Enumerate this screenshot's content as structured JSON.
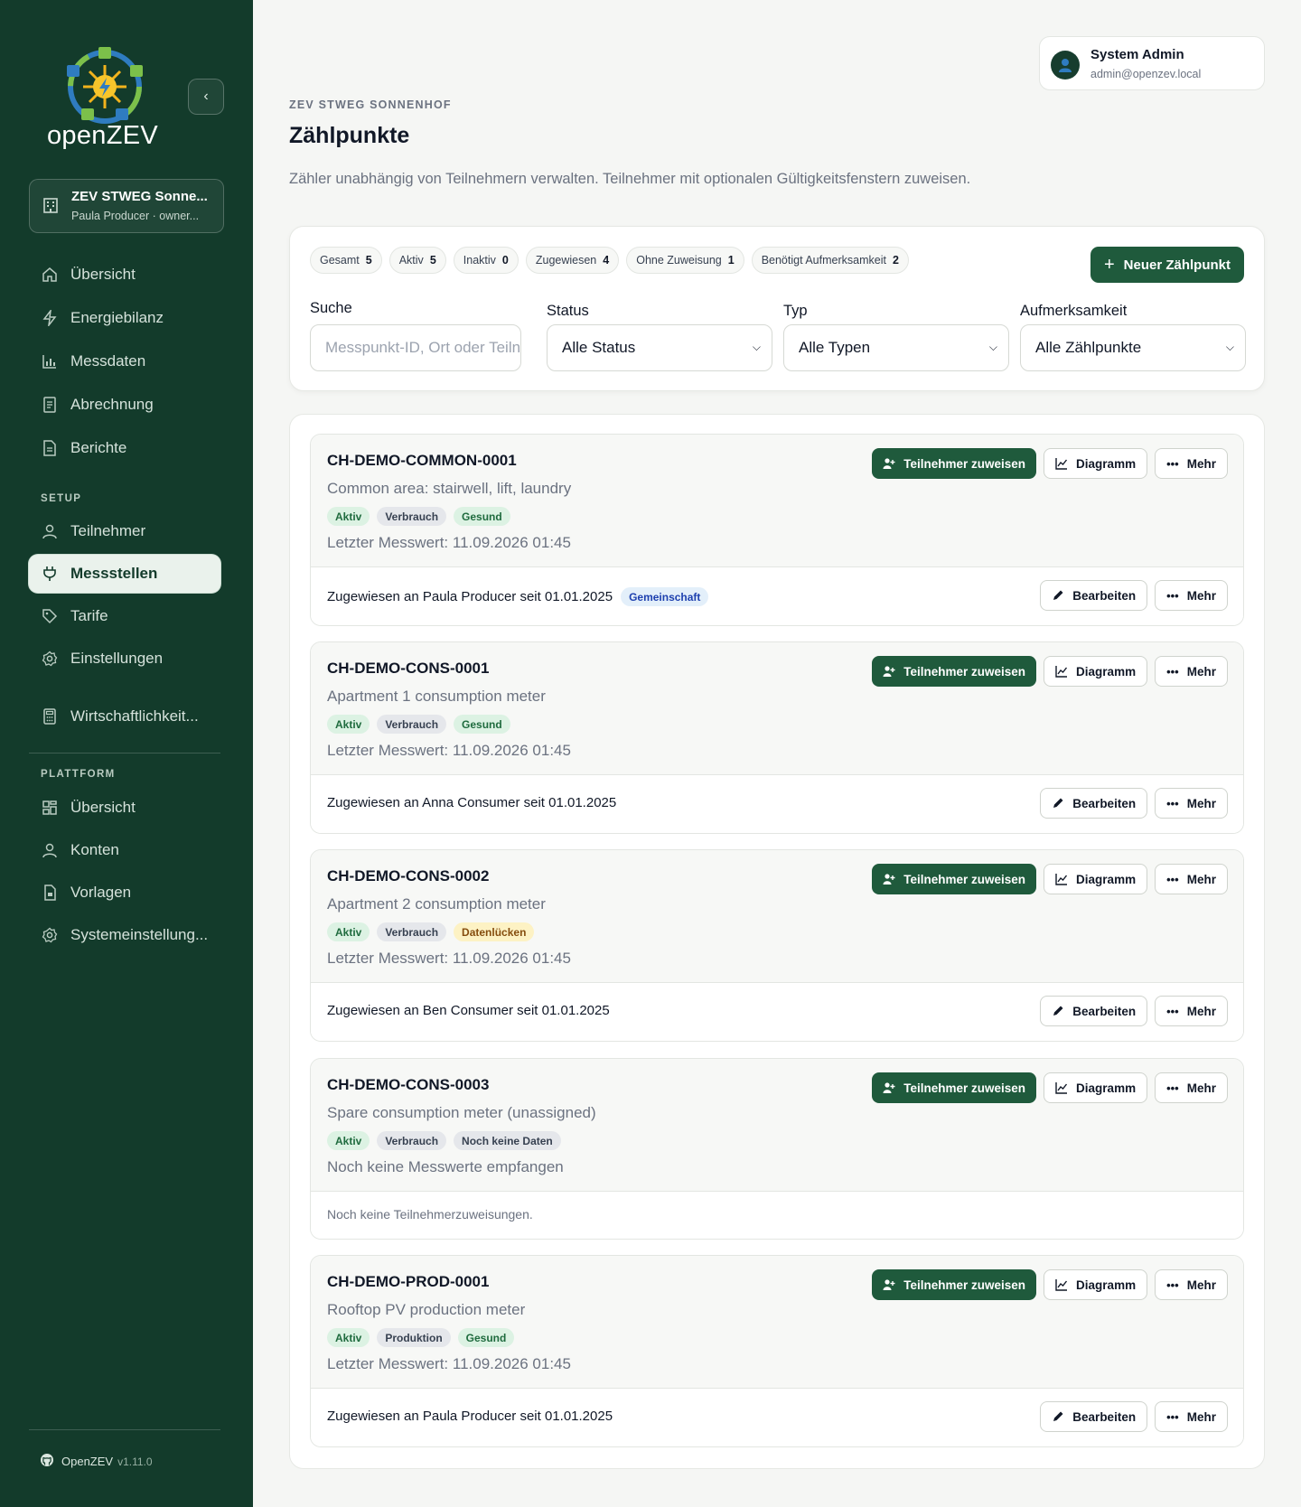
{
  "app": {
    "name": "openZEV"
  },
  "sidebar": {
    "community": {
      "title": "ZEV STWEG Sonne...",
      "subtitle": "Paula Producer · owner..."
    },
    "nav": [
      {
        "label": "Übersicht",
        "icon": "home-icon"
      },
      {
        "label": "Energiebilanz",
        "icon": "bolt-icon"
      },
      {
        "label": "Messdaten",
        "icon": "bar-chart-icon"
      },
      {
        "label": "Abrechnung",
        "icon": "receipt-icon"
      },
      {
        "label": "Berichte",
        "icon": "document-icon"
      }
    ],
    "setup_title": "SETUP",
    "setup": [
      {
        "label": "Teilnehmer",
        "icon": "user-icon"
      },
      {
        "label": "Messstellen",
        "icon": "plug-icon",
        "active": true
      },
      {
        "label": "Tarife",
        "icon": "tag-icon"
      },
      {
        "label": "Einstellungen",
        "icon": "gear-icon"
      },
      {
        "label": "Wirtschaftlichkeit...",
        "icon": "calculator-icon"
      }
    ],
    "platform_title": "PLATTFORM",
    "platform": [
      {
        "label": "Übersicht",
        "icon": "dashboard-icon"
      },
      {
        "label": "Konten",
        "icon": "user-icon"
      },
      {
        "label": "Vorlagen",
        "icon": "file-icon"
      },
      {
        "label": "Systemeinstellung...",
        "icon": "gear-icon"
      }
    ],
    "footer": {
      "label": "OpenZEV",
      "version": "v1.11.0"
    }
  },
  "user": {
    "name": "System Admin",
    "email": "admin@openzev.local"
  },
  "header": {
    "eyebrow": "ZEV STWEG SONNENHOF",
    "title": "Zählpunkte",
    "description": "Zähler unabhängig von Teilnehmern verwalten. Teilnehmer mit optionalen Gültigkeitsfenstern zuweisen."
  },
  "stats": [
    {
      "label": "Gesamt",
      "value": "5"
    },
    {
      "label": "Aktiv",
      "value": "5"
    },
    {
      "label": "Inaktiv",
      "value": "0"
    },
    {
      "label": "Zugewiesen",
      "value": "4"
    },
    {
      "label": "Ohne Zuweisung",
      "value": "1"
    },
    {
      "label": "Benötigt Aufmerksamkeit",
      "value": "2"
    }
  ],
  "new_button": "Neuer Zählpunkt",
  "filters": {
    "search_label": "Suche",
    "search_placeholder": "Messpunkt-ID, Ort oder Teiln",
    "status_label": "Status",
    "status_value": "Alle Status",
    "type_label": "Typ",
    "type_value": "Alle Typen",
    "attention_label": "Aufmerksamkeit",
    "attention_value": "Alle Zählpunkte"
  },
  "actions": {
    "assign": "Teilnehmer zuweisen",
    "chart": "Diagramm",
    "more": "Mehr",
    "edit": "Bearbeiten"
  },
  "meters": [
    {
      "id": "CH-DEMO-COMMON-0001",
      "description": "Common area: stairwell, lift, laundry",
      "tags": [
        "Aktiv",
        "Verbrauch",
        "Gesund"
      ],
      "last": "Letzter Messwert: 11.09.2026 01:45",
      "assignment": "Zugewiesen an Paula Producer seit 01.01.2025",
      "badge": "Gemeinschaft"
    },
    {
      "id": "CH-DEMO-CONS-0001",
      "description": "Apartment 1 consumption meter",
      "tags": [
        "Aktiv",
        "Verbrauch",
        "Gesund"
      ],
      "last": "Letzter Messwert: 11.09.2026 01:45",
      "assignment": "Zugewiesen an Anna Consumer seit 01.01.2025"
    },
    {
      "id": "CH-DEMO-CONS-0002",
      "description": "Apartment 2 consumption meter",
      "tags": [
        "Aktiv",
        "Verbrauch",
        "Datenlücken"
      ],
      "last": "Letzter Messwert: 11.09.2026 01:45",
      "assignment": "Zugewiesen an Ben Consumer seit 01.01.2025"
    },
    {
      "id": "CH-DEMO-CONS-0003",
      "description": "Spare consumption meter (unassigned)",
      "tags": [
        "Aktiv",
        "Verbrauch",
        "Noch keine Daten"
      ],
      "last": "Noch keine Messwerte empfangen",
      "no_assignment": "Noch keine Teilnehmerzuweisungen."
    },
    {
      "id": "CH-DEMO-PROD-0001",
      "description": "Rooftop PV production meter",
      "tags": [
        "Aktiv",
        "Produktion",
        "Gesund"
      ],
      "last": "Letzter Messwert: 11.09.2026 01:45",
      "assignment": "Zugewiesen an Paula Producer seit 01.01.2025"
    }
  ],
  "colors": {
    "sidebar_bg": "#133b2b",
    "primary": "#1f5a3c",
    "tag_green": "#dcf2e3",
    "tag_gray": "#e5e7eb",
    "tag_yellow": "#fdf2c4",
    "badge_blue": "#e3effa"
  }
}
